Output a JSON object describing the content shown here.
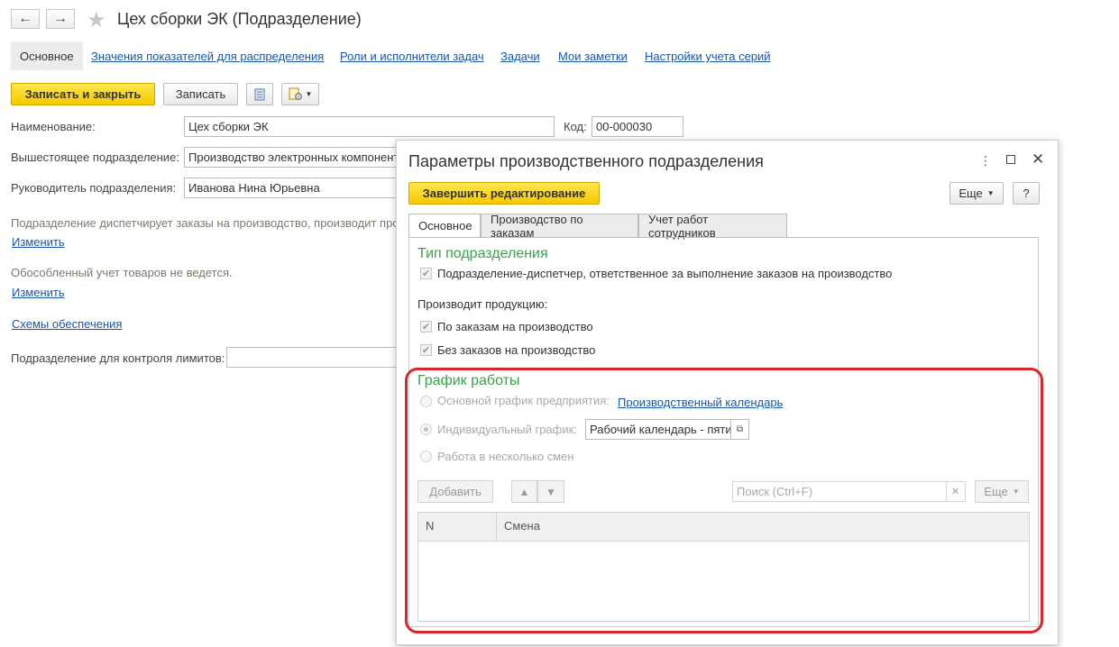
{
  "form": {
    "title": "Цех сборки ЭК (Подразделение)",
    "nav_back": "←",
    "nav_forward": "→",
    "favorite_star": "★",
    "tabs": [
      {
        "label": "Основное"
      },
      {
        "label": "Значения показателей для распределения"
      },
      {
        "label": "Роли и исполнители задач"
      },
      {
        "label": "Задачи"
      },
      {
        "label": "Мои заметки"
      },
      {
        "label": "Настройки учета серий"
      }
    ],
    "toolbar": {
      "save_close": "Записать и закрыть",
      "save": "Записать"
    },
    "fields": {
      "name_label": "Наименование:",
      "name_value": "Цех сборки ЭК",
      "code_label": "Код:",
      "code_value": "00-000030",
      "parent_label": "Вышестоящее подразделение:",
      "parent_value": "Производство электронных компонент",
      "head_label": "Руководитель подразделения:",
      "head_value": "Иванова Нина Юрьевна",
      "info1": "Подразделение диспетчирует заказы на производство, производит про",
      "change1": "Изменить",
      "info2": "Обособленный учет товаров не ведется.",
      "change2": "Изменить",
      "schemes_link": "Схемы обеспечения",
      "limits_label": "Подразделение для контроля лимитов:",
      "limits_value": ""
    }
  },
  "dialog": {
    "title": "Параметры производственного подразделения",
    "finish_button": "Завершить редактирование",
    "more_button": "Еще",
    "help_button": "?",
    "tabs": [
      {
        "label": "Основное"
      },
      {
        "label": "Производство по заказам"
      },
      {
        "label": "Учет работ сотрудников"
      }
    ],
    "type_section": "Тип подразделения",
    "dispatcher_checkbox": "Подразделение-диспетчер, ответственное за выполнение заказов на производство",
    "produces_label": "Производит продукцию:",
    "by_orders_checkbox": "По заказам на производство",
    "without_orders_checkbox": "Без заказов на производство",
    "schedule_section": "График работы",
    "main_schedule_radio": "Основной график предприятия:",
    "calendar_link": "Производственный календарь",
    "individual_radio": "Индивидуальный график:",
    "individual_value": "Рабочий календарь - пяти",
    "shifts_radio": "Работа в несколько смен",
    "add_button": "Добавить",
    "search_placeholder": "Поиск (Ctrl+F)",
    "more_button2": "Еще",
    "table_headers": [
      "N",
      "Смена"
    ]
  }
}
